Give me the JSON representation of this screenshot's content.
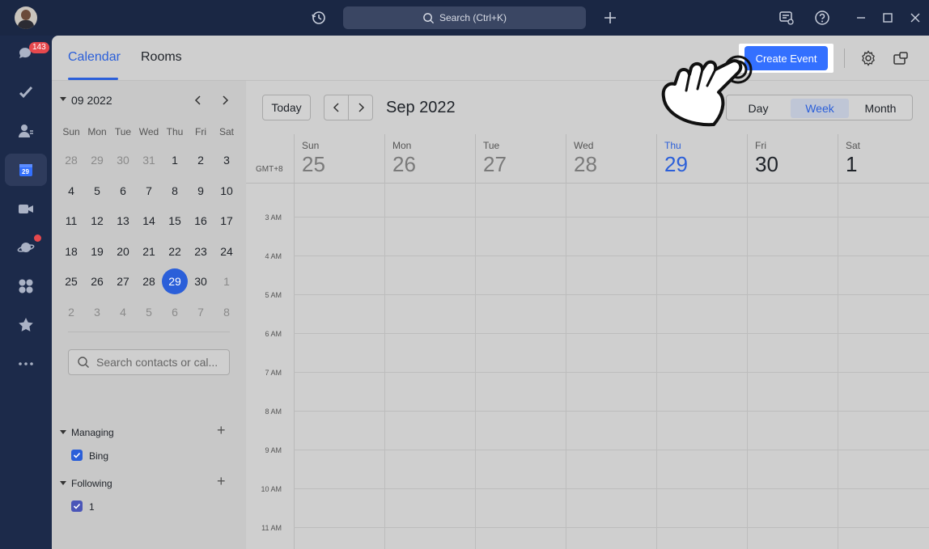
{
  "titlebar": {
    "search_placeholder": "Search (Ctrl+K)"
  },
  "rail": {
    "chat_badge": "143",
    "calendar_icon_day": "29"
  },
  "header": {
    "tabs": [
      {
        "label": "Calendar",
        "active": true
      },
      {
        "label": "Rooms",
        "active": false
      }
    ],
    "create_event_label": "Create Event"
  },
  "mini_calendar": {
    "title": "09 2022",
    "weekdays": [
      "Sun",
      "Mon",
      "Tue",
      "Wed",
      "Thu",
      "Fri",
      "Sat"
    ],
    "weeks": [
      [
        "28",
        "29",
        "30",
        "31",
        "1",
        "2",
        "3"
      ],
      [
        "4",
        "5",
        "6",
        "7",
        "8",
        "9",
        "10"
      ],
      [
        "11",
        "12",
        "13",
        "14",
        "15",
        "16",
        "17"
      ],
      [
        "18",
        "19",
        "20",
        "21",
        "22",
        "23",
        "24"
      ],
      [
        "25",
        "26",
        "27",
        "28",
        "29",
        "30",
        "1"
      ],
      [
        "2",
        "3",
        "4",
        "5",
        "6",
        "7",
        "8"
      ]
    ],
    "today": "29"
  },
  "sidebar": {
    "search_placeholder": "Search contacts or cal...",
    "groups": [
      {
        "title": "Managing",
        "items": [
          {
            "label": "Bing",
            "checked": true
          }
        ]
      },
      {
        "title": "Following",
        "items": [
          {
            "label": "1",
            "checked": true
          }
        ]
      }
    ]
  },
  "week_view": {
    "today_label": "Today",
    "range_title": "Sep 2022",
    "views": [
      "Day",
      "Week",
      "Month"
    ],
    "active_view": "Week",
    "timezone": "GMT+8",
    "days": [
      {
        "name": "Sun",
        "num": "25"
      },
      {
        "name": "Mon",
        "num": "26"
      },
      {
        "name": "Tue",
        "num": "27"
      },
      {
        "name": "Wed",
        "num": "28"
      },
      {
        "name": "Thu",
        "num": "29"
      },
      {
        "name": "Fri",
        "num": "30"
      },
      {
        "name": "Sat",
        "num": "1"
      }
    ],
    "hours": [
      "3 AM",
      "4 AM",
      "5 AM",
      "6 AM",
      "7 AM",
      "8 AM",
      "9 AM",
      "10 AM",
      "11 AM"
    ]
  },
  "colors": {
    "accent": "#2b5fd9",
    "button": "#3370ff",
    "rail_bg": "#1c2a4a",
    "badge": "#e5484d"
  }
}
